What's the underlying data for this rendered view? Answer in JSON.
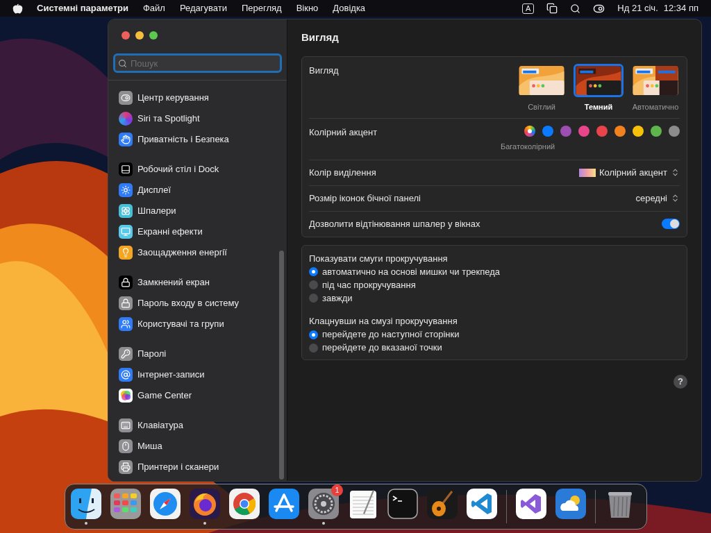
{
  "menubar": {
    "app_name": "Системні параметри",
    "menus": [
      "Файл",
      "Редагувати",
      "Перегляд",
      "Вікно",
      "Довідка"
    ],
    "input_source": "A",
    "date": "Нд 21 січ.",
    "time": "12:34 пп"
  },
  "sidebar": {
    "search": {
      "placeholder": "Пошук"
    },
    "groups": [
      {
        "items": [
          "Центр керування",
          "Siri та Spotlight",
          "Приватність і Безпека"
        ]
      },
      {
        "items": [
          "Робочий стіл і Dock",
          "Дисплеї",
          "Шпалери",
          "Екранні ефекти",
          "Заощадження енергії"
        ]
      },
      {
        "items": [
          "Замкнений екран",
          "Пароль входу в систему",
          "Користувачі та групи"
        ]
      },
      {
        "items": [
          "Паролі",
          "Інтернет-записи",
          "Game Center"
        ]
      },
      {
        "items": [
          "Клавіатура",
          "Миша",
          "Принтери і сканери"
        ]
      }
    ]
  },
  "content": {
    "title": "Вигляд",
    "appearance": {
      "label": "Вигляд",
      "options": [
        {
          "kind": "light",
          "label": "Світлий",
          "selected": false
        },
        {
          "kind": "dark",
          "label": "Темний",
          "selected": true
        },
        {
          "kind": "auto",
          "label": "Автоматично",
          "selected": false
        }
      ]
    },
    "accent": {
      "label": "Колірний акцент",
      "caption": "Багатоколірний",
      "colors": [
        {
          "kind": "multi",
          "selected": true
        },
        {
          "color": "#0a7aff",
          "selected": false
        },
        {
          "color": "#9b4fb0",
          "selected": false
        },
        {
          "color": "#e8458b",
          "selected": false
        },
        {
          "color": "#e9444b",
          "selected": false
        },
        {
          "color": "#f2821f",
          "selected": false
        },
        {
          "color": "#f7c10a",
          "selected": false
        },
        {
          "color": "#5db54b",
          "selected": false
        },
        {
          "color": "#8c8c8c",
          "selected": false
        }
      ]
    },
    "highlight": {
      "label": "Колір виділення",
      "value": "Колірний акцент"
    },
    "icon_size": {
      "label": "Розмір іконок бічної панелі",
      "value": "середні"
    },
    "tinting": {
      "label": "Дозволити відтінювання шпалер у вікнах",
      "on": true
    },
    "scroll_bars": {
      "label": "Показувати смуги прокручування",
      "options": [
        {
          "label": "автоматично на основі мишки чи трекпеда",
          "selected": true
        },
        {
          "label": "під час прокручування",
          "selected": false
        },
        {
          "label": "завжди",
          "selected": false
        }
      ]
    },
    "scroll_click": {
      "label": "Клацнувши на смузі прокручування",
      "options": [
        {
          "label": "перейдете до наступної сторінки",
          "selected": true
        },
        {
          "label": "перейдете до вказаної точки",
          "selected": false
        }
      ]
    },
    "help": "?"
  },
  "dock": {
    "items": [
      {
        "kind": "finder",
        "running": true
      },
      {
        "kind": "launchpad",
        "running": false
      },
      {
        "kind": "safari",
        "running": false
      },
      {
        "kind": "firefox",
        "running": true
      },
      {
        "kind": "chrome",
        "running": false
      },
      {
        "kind": "appstore",
        "running": false
      },
      {
        "kind": "settings",
        "running": true,
        "badge": "1"
      },
      {
        "kind": "textedit",
        "running": false
      },
      {
        "kind": "terminal",
        "running": false
      },
      {
        "kind": "guitar",
        "running": false
      },
      {
        "kind": "vscode",
        "running": false
      },
      {
        "kind": "separator"
      },
      {
        "kind": "vs",
        "running": false
      },
      {
        "kind": "weather",
        "running": false
      },
      {
        "kind": "separator"
      },
      {
        "kind": "trash",
        "running": false
      }
    ]
  }
}
